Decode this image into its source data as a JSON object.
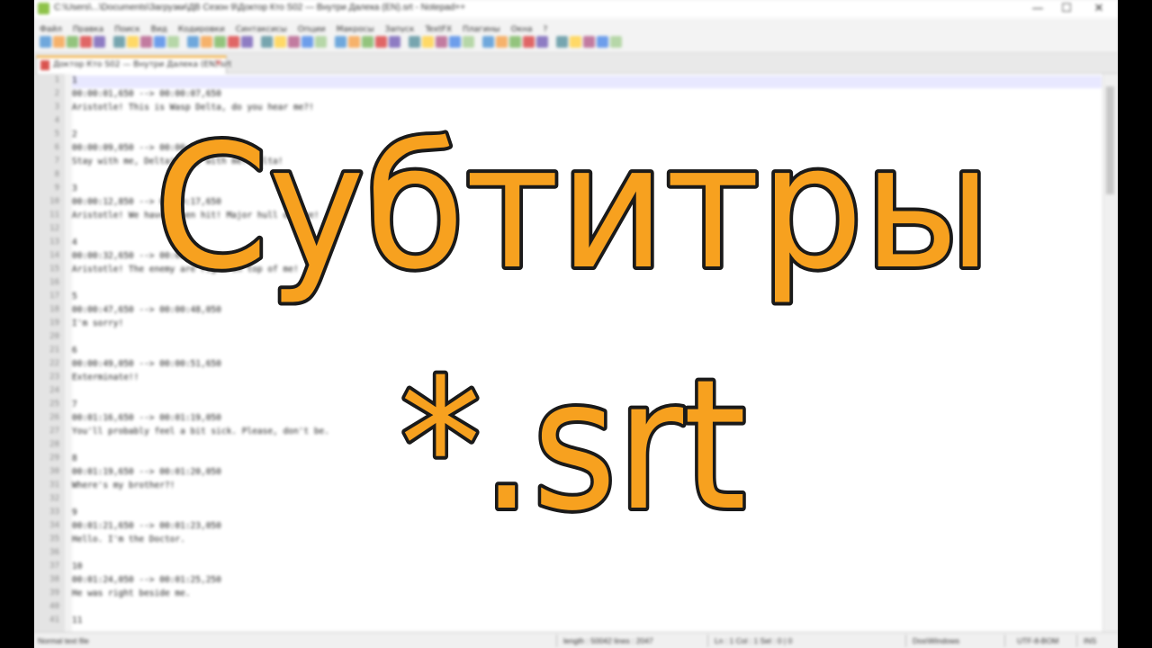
{
  "window": {
    "title": "C:\\Users\\...\\Documents\\Загрузки\\ДВ Сезон 9\\Доктор Кто S02 — Внутри Далека (EN).srt - Notepad++",
    "minimize_icon": "minimize-icon",
    "maximize_icon": "maximize-icon",
    "close_icon": "close-icon"
  },
  "menu": [
    "Файл",
    "Правка",
    "Поиск",
    "Вид",
    "Кодировки",
    "Синтаксисы",
    "Опции",
    "Макросы",
    "Запуск",
    "TextFX",
    "Плагины",
    "Окна",
    "?"
  ],
  "tab": {
    "label": "Доктор Кто S02 — Внутри Далека (EN).srt",
    "close": "✕"
  },
  "editor": {
    "lines": [
      "1",
      "00:00:01,650 --> 00:00:07,650",
      "Aristotle! This is Wasp Delta, do you hear me?!",
      "",
      "2",
      "00:00:09,050 --> 00:00:10,250",
      "Stay with me, Delta! Stay with me! Delta!",
      "",
      "3",
      "00:00:12,850 --> 00:00:17,650",
      "Aristotle! We have taken hit! Major hull damage!",
      "",
      "4",
      "00:00:32,650 --> 00:00:36,850",
      "Aristotle! The enemy are right on top of me!",
      "",
      "5",
      "00:00:47,650 --> 00:00:48,050",
      "I'm sorry!",
      "",
      "6",
      "00:00:49,050 --> 00:00:51,650",
      "Exterminate!!",
      "",
      "7",
      "00:01:16,650 --> 00:01:19,050",
      "You'll probably feel a bit sick. Please, don't be.",
      "",
      "8",
      "00:01:19,650 --> 00:01:20,050",
      "Where's my brother?!",
      "",
      "9",
      "00:01:21,650 --> 00:01:23,050",
      "Hello. I'm the Doctor.",
      "",
      "10",
      "00:01:24,050 --> 00:01:25,250",
      "He was right beside me.",
      "",
      "11"
    ]
  },
  "status": {
    "file_type": "Normal text file",
    "length": "length : 50042    lines : 2047",
    "position": "Ln : 1    Col : 1    Sel : 0 | 0",
    "eol": "Dos\\Windows",
    "encoding": "UTF-8-BOM",
    "mode": "INS"
  },
  "overlay": {
    "title": "Субтитры",
    "subtitle": "*.srt",
    "fill_color": "#f7a11f",
    "stroke_color": "#1a1a1a"
  }
}
